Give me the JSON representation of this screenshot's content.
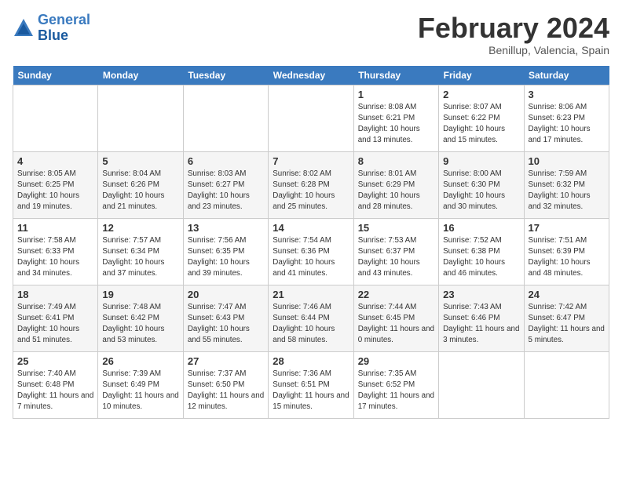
{
  "header": {
    "logo_line1": "General",
    "logo_line2": "Blue",
    "month_title": "February 2024",
    "subtitle": "Benillup, Valencia, Spain"
  },
  "days_of_week": [
    "Sunday",
    "Monday",
    "Tuesday",
    "Wednesday",
    "Thursday",
    "Friday",
    "Saturday"
  ],
  "weeks": [
    [
      {
        "day": "",
        "info": ""
      },
      {
        "day": "",
        "info": ""
      },
      {
        "day": "",
        "info": ""
      },
      {
        "day": "",
        "info": ""
      },
      {
        "day": "1",
        "info": "Sunrise: 8:08 AM\nSunset: 6:21 PM\nDaylight: 10 hours\nand 13 minutes."
      },
      {
        "day": "2",
        "info": "Sunrise: 8:07 AM\nSunset: 6:22 PM\nDaylight: 10 hours\nand 15 minutes."
      },
      {
        "day": "3",
        "info": "Sunrise: 8:06 AM\nSunset: 6:23 PM\nDaylight: 10 hours\nand 17 minutes."
      }
    ],
    [
      {
        "day": "4",
        "info": "Sunrise: 8:05 AM\nSunset: 6:25 PM\nDaylight: 10 hours\nand 19 minutes."
      },
      {
        "day": "5",
        "info": "Sunrise: 8:04 AM\nSunset: 6:26 PM\nDaylight: 10 hours\nand 21 minutes."
      },
      {
        "day": "6",
        "info": "Sunrise: 8:03 AM\nSunset: 6:27 PM\nDaylight: 10 hours\nand 23 minutes."
      },
      {
        "day": "7",
        "info": "Sunrise: 8:02 AM\nSunset: 6:28 PM\nDaylight: 10 hours\nand 25 minutes."
      },
      {
        "day": "8",
        "info": "Sunrise: 8:01 AM\nSunset: 6:29 PM\nDaylight: 10 hours\nand 28 minutes."
      },
      {
        "day": "9",
        "info": "Sunrise: 8:00 AM\nSunset: 6:30 PM\nDaylight: 10 hours\nand 30 minutes."
      },
      {
        "day": "10",
        "info": "Sunrise: 7:59 AM\nSunset: 6:32 PM\nDaylight: 10 hours\nand 32 minutes."
      }
    ],
    [
      {
        "day": "11",
        "info": "Sunrise: 7:58 AM\nSunset: 6:33 PM\nDaylight: 10 hours\nand 34 minutes."
      },
      {
        "day": "12",
        "info": "Sunrise: 7:57 AM\nSunset: 6:34 PM\nDaylight: 10 hours\nand 37 minutes."
      },
      {
        "day": "13",
        "info": "Sunrise: 7:56 AM\nSunset: 6:35 PM\nDaylight: 10 hours\nand 39 minutes."
      },
      {
        "day": "14",
        "info": "Sunrise: 7:54 AM\nSunset: 6:36 PM\nDaylight: 10 hours\nand 41 minutes."
      },
      {
        "day": "15",
        "info": "Sunrise: 7:53 AM\nSunset: 6:37 PM\nDaylight: 10 hours\nand 43 minutes."
      },
      {
        "day": "16",
        "info": "Sunrise: 7:52 AM\nSunset: 6:38 PM\nDaylight: 10 hours\nand 46 minutes."
      },
      {
        "day": "17",
        "info": "Sunrise: 7:51 AM\nSunset: 6:39 PM\nDaylight: 10 hours\nand 48 minutes."
      }
    ],
    [
      {
        "day": "18",
        "info": "Sunrise: 7:49 AM\nSunset: 6:41 PM\nDaylight: 10 hours\nand 51 minutes."
      },
      {
        "day": "19",
        "info": "Sunrise: 7:48 AM\nSunset: 6:42 PM\nDaylight: 10 hours\nand 53 minutes."
      },
      {
        "day": "20",
        "info": "Sunrise: 7:47 AM\nSunset: 6:43 PM\nDaylight: 10 hours\nand 55 minutes."
      },
      {
        "day": "21",
        "info": "Sunrise: 7:46 AM\nSunset: 6:44 PM\nDaylight: 10 hours\nand 58 minutes."
      },
      {
        "day": "22",
        "info": "Sunrise: 7:44 AM\nSunset: 6:45 PM\nDaylight: 11 hours\nand 0 minutes."
      },
      {
        "day": "23",
        "info": "Sunrise: 7:43 AM\nSunset: 6:46 PM\nDaylight: 11 hours\nand 3 minutes."
      },
      {
        "day": "24",
        "info": "Sunrise: 7:42 AM\nSunset: 6:47 PM\nDaylight: 11 hours\nand 5 minutes."
      }
    ],
    [
      {
        "day": "25",
        "info": "Sunrise: 7:40 AM\nSunset: 6:48 PM\nDaylight: 11 hours\nand 7 minutes."
      },
      {
        "day": "26",
        "info": "Sunrise: 7:39 AM\nSunset: 6:49 PM\nDaylight: 11 hours\nand 10 minutes."
      },
      {
        "day": "27",
        "info": "Sunrise: 7:37 AM\nSunset: 6:50 PM\nDaylight: 11 hours\nand 12 minutes."
      },
      {
        "day": "28",
        "info": "Sunrise: 7:36 AM\nSunset: 6:51 PM\nDaylight: 11 hours\nand 15 minutes."
      },
      {
        "day": "29",
        "info": "Sunrise: 7:35 AM\nSunset: 6:52 PM\nDaylight: 11 hours\nand 17 minutes."
      },
      {
        "day": "",
        "info": ""
      },
      {
        "day": "",
        "info": ""
      }
    ]
  ]
}
